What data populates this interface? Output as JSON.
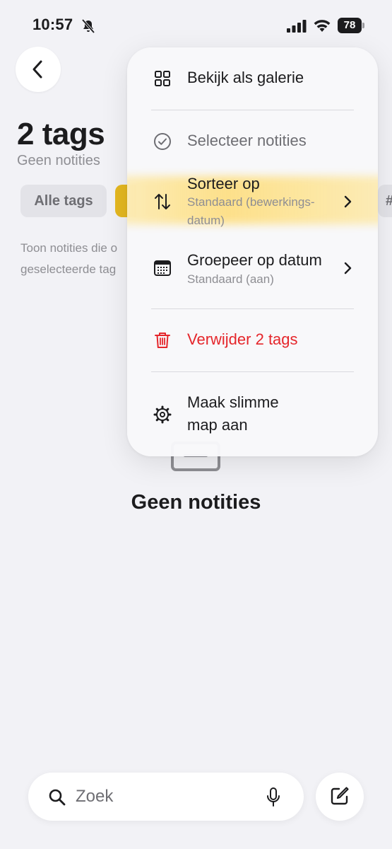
{
  "status_bar": {
    "time": "10:57",
    "battery": "78"
  },
  "header": {
    "title": "2 tags",
    "subtitle": "Geen notities"
  },
  "filters": {
    "all_label": "Alle tags",
    "right_chip_label": "#"
  },
  "hint": {
    "line1": "Toon notities die o",
    "line2": "geselecteerde tag"
  },
  "empty_state": {
    "title": "Geen notities"
  },
  "menu": {
    "gallery": "Bekijk als galerie",
    "select": "Selecteer notities",
    "sort": {
      "label": "Sorteer op",
      "sub_line1": "Standaard (bewerkings-",
      "sub_line2": "datum)"
    },
    "group": {
      "label": "Groepeer op datum",
      "sub": "Standaard (aan)"
    },
    "delete": "Verwijder 2 tags",
    "smart_folder": {
      "line1": "Maak slimme",
      "line2": "map aan"
    }
  },
  "search": {
    "placeholder": "Zoek"
  },
  "colors": {
    "accent_yellow": "#e5b820",
    "danger_red": "#e5262b",
    "background": "#f2f2f6"
  },
  "icons": {
    "back": "chevron-left-icon",
    "gallery": "grid-icon",
    "select": "checkmark-circle-icon",
    "sort": "sort-arrows-icon",
    "group": "calendar-icon",
    "delete": "trash-icon",
    "smart_folder": "gear-icon",
    "search": "search-icon",
    "mic": "mic-icon",
    "compose": "compose-icon"
  }
}
